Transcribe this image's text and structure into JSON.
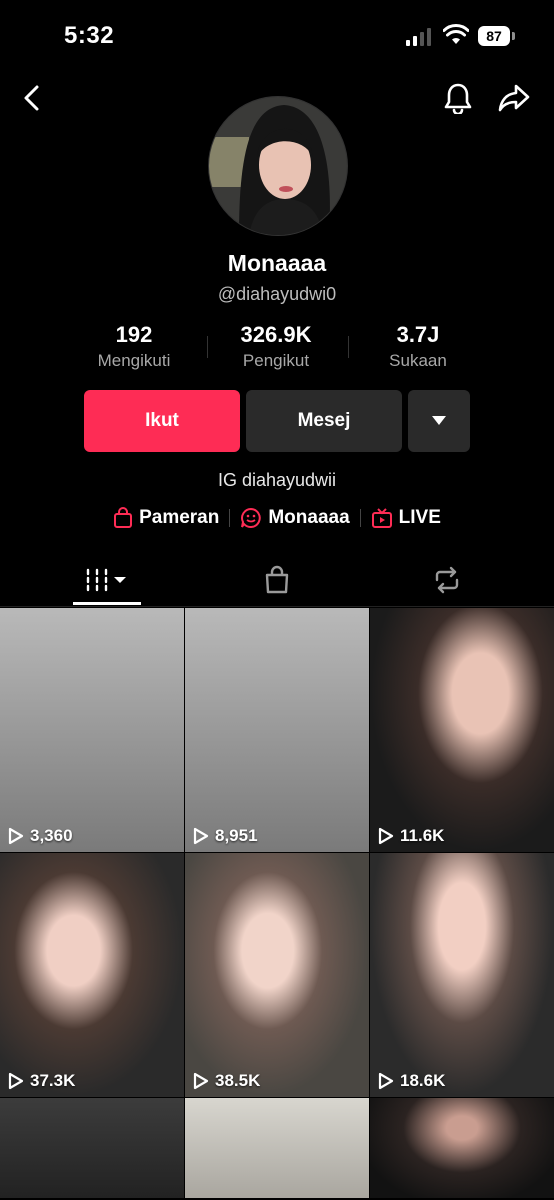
{
  "status_bar": {
    "time": "5:32",
    "battery": "87"
  },
  "profile": {
    "display_name": "Monaaaa",
    "username": "@diahayudwi0",
    "stats": [
      {
        "value": "192",
        "label": "Mengikuti"
      },
      {
        "value": "326.9K",
        "label": "Pengikut"
      },
      {
        "value": "3.7J",
        "label": "Sukaan"
      }
    ],
    "buttons": {
      "follow": "Ikut",
      "message": "Mesej"
    },
    "bio": "IG diahayudwii",
    "links": [
      {
        "label": "Pameran",
        "icon": "shopping-bag-icon"
      },
      {
        "label": "Monaaaa",
        "icon": "smiley-chat-icon"
      },
      {
        "label": "LIVE",
        "icon": "tv-icon"
      }
    ]
  },
  "tabs": [
    {
      "icon": "videos-grid-icon",
      "active": true
    },
    {
      "icon": "shop-bag-icon",
      "active": false
    },
    {
      "icon": "repost-icon",
      "active": false
    }
  ],
  "videos": [
    {
      "views": "3,360"
    },
    {
      "views": "8,951"
    },
    {
      "views": "11.6K"
    },
    {
      "views": "37.3K"
    },
    {
      "views": "38.5K"
    },
    {
      "views": "18.6K"
    }
  ],
  "colors": {
    "accent": "#fe2c55",
    "background": "#000000",
    "button_dark": "#2a2a2a"
  }
}
